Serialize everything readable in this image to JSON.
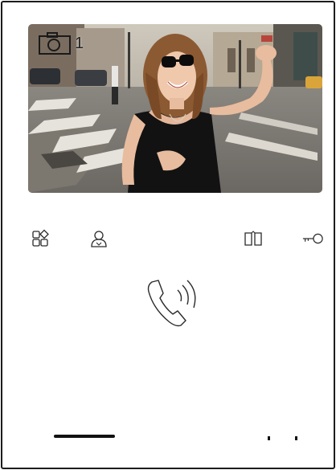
{
  "video": {
    "snapshot_count": "1"
  },
  "icons": {
    "apps": "apps-icon",
    "contacts": "contact-icon",
    "door": "door-icon",
    "key": "key-icon",
    "call": "call-answer-icon"
  },
  "colors": {
    "icon": "#2a2a2a",
    "frame": "#1c1c1c"
  }
}
